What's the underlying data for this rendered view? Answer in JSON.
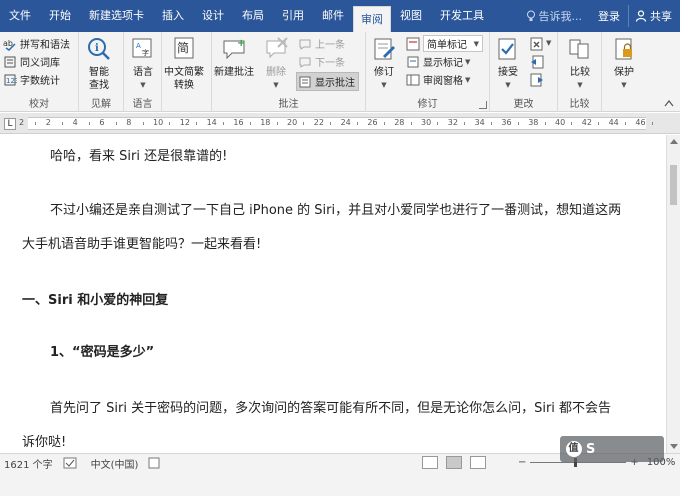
{
  "tabs": [
    {
      "label": "文件"
    },
    {
      "label": "开始"
    },
    {
      "label": "新建选项卡"
    },
    {
      "label": "插入"
    },
    {
      "label": "设计"
    },
    {
      "label": "布局"
    },
    {
      "label": "引用"
    },
    {
      "label": "邮件"
    },
    {
      "label": "审阅",
      "active": true
    },
    {
      "label": "视图"
    },
    {
      "label": "开发工具"
    }
  ],
  "tellme": {
    "label": "告诉我..."
  },
  "account": {
    "login": "登录",
    "share": "共享"
  },
  "ribbon": {
    "proofing": {
      "label": "校对",
      "spelling": "拼写和语法",
      "thesaurus": "同义词库",
      "wordcount": "字数统计"
    },
    "insights": {
      "label": "见解",
      "smart_lookup_line1": "智能",
      "smart_lookup_line2": "查找"
    },
    "language": {
      "label": "语言",
      "language_btn": "语言"
    },
    "chinese": {
      "label_line1": "中文简繁",
      "label_line2": "转换"
    },
    "comments": {
      "label": "批注",
      "new_comment_line1": "新建批注",
      "delete": "删除",
      "previous": "上一条",
      "next": "下一条",
      "show_comments": "显示批注"
    },
    "tracking": {
      "label": "修订",
      "track_changes": "修订",
      "markup_select": "简单标记",
      "show_markup": "显示标记",
      "reviewing_pane": "审阅窗格"
    },
    "changes": {
      "label": "更改",
      "accept": "接受"
    },
    "compare": {
      "label": "比较",
      "compare_btn": "比较"
    },
    "protect": {
      "label": "保护",
      "protect_btn": "保护"
    }
  },
  "ruler": {
    "numbers": [
      "2",
      "2",
      "4",
      "6",
      "8",
      "10",
      "12",
      "14",
      "16",
      "18",
      "20",
      "22",
      "24",
      "26",
      "28",
      "30",
      "32",
      "34",
      "36",
      "38",
      "40",
      "42",
      "44",
      "46"
    ],
    "tab_symbol": "L"
  },
  "document": {
    "para1": "哈哈，看来 Siri 还是很靠谱的!",
    "para2_line1": "不过小编还是亲自测试了一下自己 iPhone 的 Siri，并且对小爱同学也进行了一番测试，想知道这两",
    "para2_line2": "大手机语音助手谁更智能吗？一起来看看!",
    "heading1": "一、Siri 和小爱的神回复",
    "heading2": "1、“密码是多少”",
    "para3_line1": "首先问了 Siri 关于密码的问题，多次询问的答案可能有所不同，但是无论你怎么问，Siri 都不会告",
    "para3_line2": "诉你哒!"
  },
  "status": {
    "wordcount": "1621 个字",
    "language": "中文(中国)",
    "zoom_minus": "−",
    "zoom_plus": "+",
    "zoom_percent": "100%"
  },
  "watermark": {
    "text": "S",
    "icon_char": "值"
  },
  "colors": {
    "accent": "#2b579a",
    "ribbon_bg": "#f3f3f3",
    "icon_blue": "#2b6cb0"
  }
}
